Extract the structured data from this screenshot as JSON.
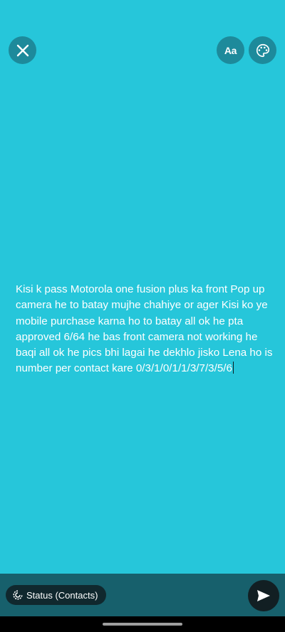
{
  "colors": {
    "background": "#26c6da",
    "button": "#1d8a9b",
    "bottom_bar": "#17606c",
    "pill": "#10282e",
    "send": "#121f23"
  },
  "toolbar": {
    "close_icon": "close-icon",
    "font_label": "Aa",
    "palette_icon": "palette-icon"
  },
  "composer": {
    "text": "Kisi k pass Motorola one fusion plus ka front Pop up camera he to batay mujhe chahiye or ager Kisi ko ye mobile purchase karna ho to batay all ok he pta approved 6/64 he bas front camera not working he baqi all ok he pics bhi lagai he dekhlo jisko Lena ho is number per contact kare 0/3/1/0/1/1/3/7/3/5/6"
  },
  "footer": {
    "status_icon": "status-icon",
    "status_label": "Status (Contacts)",
    "send_icon": "send-icon"
  }
}
